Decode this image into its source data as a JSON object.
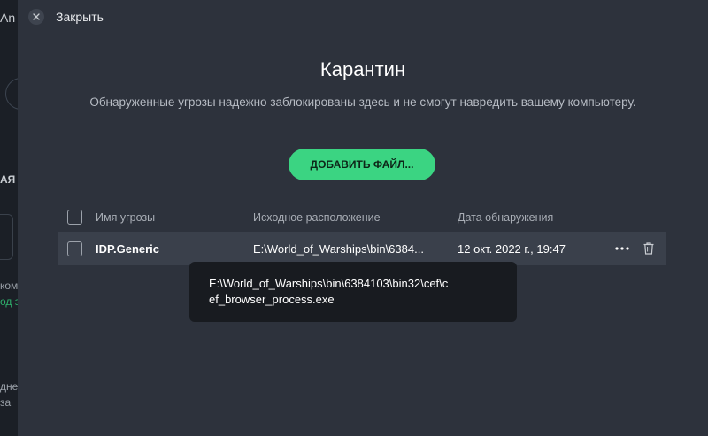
{
  "background_app": {
    "title_fragment": "An",
    "label_fragment_1": "АЯ З",
    "label_fragment_2": "ком",
    "label_fragment_3": "од з",
    "label_fragment_4": "дне",
    "label_fragment_5": "за"
  },
  "close": {
    "label": "Закрыть",
    "icon": "close-icon"
  },
  "header": {
    "title": "Карантин",
    "description": "Обнаруженные угрозы надежно заблокированы здесь и не смогут навредить вашему компьютеру."
  },
  "add_file_button": {
    "label": "ДОБАВИТЬ ФАЙЛ..."
  },
  "table": {
    "columns": [
      "Имя угрозы",
      "Исходное расположение",
      "Дата обнаружения"
    ],
    "rows": [
      {
        "threat_name": "IDP.Generic",
        "location": "E:\\World_of_Warships\\bin\\6384103\\bin32\\cef\\cef_browser_process.exe",
        "location_truncated": "E:\\World_of_Warships\\bin\\6384...",
        "date": "12 окт. 2022 г., 19:47"
      }
    ]
  },
  "tooltip": {
    "line1": "E:\\World_of_Warships\\bin\\6384103\\bin32\\cef\\c",
    "line2": "ef_browser_process.exe"
  },
  "colors": {
    "accent": "#3bd482",
    "panel": "#2d323c",
    "row_highlight": "#3a404b",
    "tooltip": "#181b20"
  }
}
